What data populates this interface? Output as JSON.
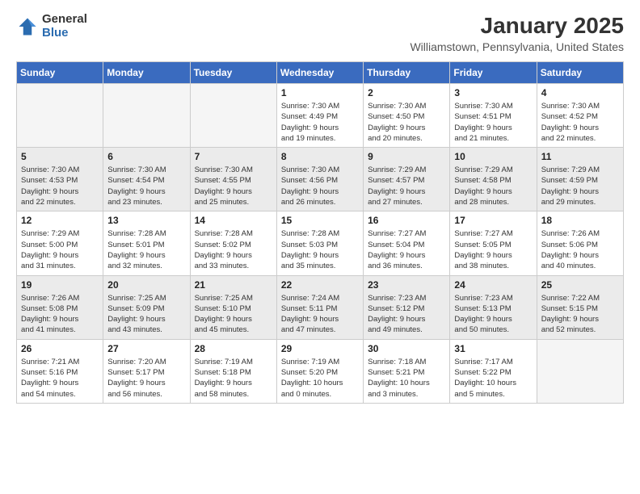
{
  "logo": {
    "general": "General",
    "blue": "Blue"
  },
  "title": {
    "month": "January 2025",
    "location": "Williamstown, Pennsylvania, United States"
  },
  "weekdays": [
    "Sunday",
    "Monday",
    "Tuesday",
    "Wednesday",
    "Thursday",
    "Friday",
    "Saturday"
  ],
  "weeks": [
    [
      {
        "day": "",
        "info": ""
      },
      {
        "day": "",
        "info": ""
      },
      {
        "day": "",
        "info": ""
      },
      {
        "day": "1",
        "info": "Sunrise: 7:30 AM\nSunset: 4:49 PM\nDaylight: 9 hours\nand 19 minutes."
      },
      {
        "day": "2",
        "info": "Sunrise: 7:30 AM\nSunset: 4:50 PM\nDaylight: 9 hours\nand 20 minutes."
      },
      {
        "day": "3",
        "info": "Sunrise: 7:30 AM\nSunset: 4:51 PM\nDaylight: 9 hours\nand 21 minutes."
      },
      {
        "day": "4",
        "info": "Sunrise: 7:30 AM\nSunset: 4:52 PM\nDaylight: 9 hours\nand 22 minutes."
      }
    ],
    [
      {
        "day": "5",
        "info": "Sunrise: 7:30 AM\nSunset: 4:53 PM\nDaylight: 9 hours\nand 22 minutes."
      },
      {
        "day": "6",
        "info": "Sunrise: 7:30 AM\nSunset: 4:54 PM\nDaylight: 9 hours\nand 23 minutes."
      },
      {
        "day": "7",
        "info": "Sunrise: 7:30 AM\nSunset: 4:55 PM\nDaylight: 9 hours\nand 25 minutes."
      },
      {
        "day": "8",
        "info": "Sunrise: 7:30 AM\nSunset: 4:56 PM\nDaylight: 9 hours\nand 26 minutes."
      },
      {
        "day": "9",
        "info": "Sunrise: 7:29 AM\nSunset: 4:57 PM\nDaylight: 9 hours\nand 27 minutes."
      },
      {
        "day": "10",
        "info": "Sunrise: 7:29 AM\nSunset: 4:58 PM\nDaylight: 9 hours\nand 28 minutes."
      },
      {
        "day": "11",
        "info": "Sunrise: 7:29 AM\nSunset: 4:59 PM\nDaylight: 9 hours\nand 29 minutes."
      }
    ],
    [
      {
        "day": "12",
        "info": "Sunrise: 7:29 AM\nSunset: 5:00 PM\nDaylight: 9 hours\nand 31 minutes."
      },
      {
        "day": "13",
        "info": "Sunrise: 7:28 AM\nSunset: 5:01 PM\nDaylight: 9 hours\nand 32 minutes."
      },
      {
        "day": "14",
        "info": "Sunrise: 7:28 AM\nSunset: 5:02 PM\nDaylight: 9 hours\nand 33 minutes."
      },
      {
        "day": "15",
        "info": "Sunrise: 7:28 AM\nSunset: 5:03 PM\nDaylight: 9 hours\nand 35 minutes."
      },
      {
        "day": "16",
        "info": "Sunrise: 7:27 AM\nSunset: 5:04 PM\nDaylight: 9 hours\nand 36 minutes."
      },
      {
        "day": "17",
        "info": "Sunrise: 7:27 AM\nSunset: 5:05 PM\nDaylight: 9 hours\nand 38 minutes."
      },
      {
        "day": "18",
        "info": "Sunrise: 7:26 AM\nSunset: 5:06 PM\nDaylight: 9 hours\nand 40 minutes."
      }
    ],
    [
      {
        "day": "19",
        "info": "Sunrise: 7:26 AM\nSunset: 5:08 PM\nDaylight: 9 hours\nand 41 minutes."
      },
      {
        "day": "20",
        "info": "Sunrise: 7:25 AM\nSunset: 5:09 PM\nDaylight: 9 hours\nand 43 minutes."
      },
      {
        "day": "21",
        "info": "Sunrise: 7:25 AM\nSunset: 5:10 PM\nDaylight: 9 hours\nand 45 minutes."
      },
      {
        "day": "22",
        "info": "Sunrise: 7:24 AM\nSunset: 5:11 PM\nDaylight: 9 hours\nand 47 minutes."
      },
      {
        "day": "23",
        "info": "Sunrise: 7:23 AM\nSunset: 5:12 PM\nDaylight: 9 hours\nand 49 minutes."
      },
      {
        "day": "24",
        "info": "Sunrise: 7:23 AM\nSunset: 5:13 PM\nDaylight: 9 hours\nand 50 minutes."
      },
      {
        "day": "25",
        "info": "Sunrise: 7:22 AM\nSunset: 5:15 PM\nDaylight: 9 hours\nand 52 minutes."
      }
    ],
    [
      {
        "day": "26",
        "info": "Sunrise: 7:21 AM\nSunset: 5:16 PM\nDaylight: 9 hours\nand 54 minutes."
      },
      {
        "day": "27",
        "info": "Sunrise: 7:20 AM\nSunset: 5:17 PM\nDaylight: 9 hours\nand 56 minutes."
      },
      {
        "day": "28",
        "info": "Sunrise: 7:19 AM\nSunset: 5:18 PM\nDaylight: 9 hours\nand 58 minutes."
      },
      {
        "day": "29",
        "info": "Sunrise: 7:19 AM\nSunset: 5:20 PM\nDaylight: 10 hours\nand 0 minutes."
      },
      {
        "day": "30",
        "info": "Sunrise: 7:18 AM\nSunset: 5:21 PM\nDaylight: 10 hours\nand 3 minutes."
      },
      {
        "day": "31",
        "info": "Sunrise: 7:17 AM\nSunset: 5:22 PM\nDaylight: 10 hours\nand 5 minutes."
      },
      {
        "day": "",
        "info": ""
      }
    ]
  ]
}
